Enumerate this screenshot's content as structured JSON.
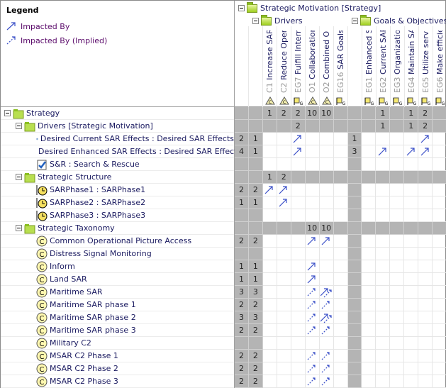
{
  "legend": {
    "title": "Legend",
    "items": [
      {
        "label": "Impacted By",
        "icon": "impact-arrow-icon"
      },
      {
        "label": "Impacted By (Implied)",
        "icon": "implied-arrow-icon"
      }
    ]
  },
  "colors": {
    "arrow": "#3a4fc8",
    "gray": "#b4b4b4"
  },
  "column_groups": {
    "root": "Strategic Motivation [Strategy]",
    "drivers": "Drivers",
    "goals": "Goals & Objectives"
  },
  "columns": [
    {
      "id": "",
      "name": "",
      "summary": true
    },
    {
      "id": "",
      "name": "",
      "summary": true
    },
    {
      "id": "C1",
      "name": "Increase SAR Sy",
      "icon": "concern"
    },
    {
      "id": "C2",
      "name": "Reduce Operati",
      "icon": "concern"
    },
    {
      "id": "EG7",
      "name": "Fulfill Internati",
      "icon": "goal"
    },
    {
      "id": "O1",
      "name": "Collaboration w",
      "icon": "concern"
    },
    {
      "id": "O2",
      "name": "Combined Oper",
      "icon": "concern"
    },
    {
      "id": "EG16",
      "name": "SAR Goals",
      "icon": "goal"
    },
    {
      "id": "",
      "name": "",
      "summary": true
    },
    {
      "id": "EG1",
      "name": "Enhanced SAR",
      "icon": "goal"
    },
    {
      "id": "EG2",
      "name": "Current SAR C",
      "icon": "goal"
    },
    {
      "id": "EG3",
      "name": "Organizational",
      "icon": "goal"
    },
    {
      "id": "EG4",
      "name": "Maintain SAR F",
      "icon": "goal"
    },
    {
      "id": "EG5",
      "name": "Utilize services",
      "icon": "goal"
    },
    {
      "id": "EG6",
      "name": "Make efficient",
      "icon": "goal"
    }
  ],
  "rows": [
    {
      "label": "Strategy",
      "level": 0,
      "icon": "folder",
      "summary": true,
      "cells": [
        "",
        "",
        "1",
        "2",
        "2",
        "10",
        "10",
        "",
        "",
        "",
        "1",
        "",
        "1",
        "2",
        ""
      ]
    },
    {
      "label": "Drivers [Strategic Motivation]",
      "level": 1,
      "icon": "folder",
      "summary": true,
      "cells": [
        "",
        "",
        "",
        "",
        "2",
        "",
        "",
        "",
        "",
        "",
        "1",
        "",
        "1",
        "2",
        ""
      ]
    },
    {
      "label": "Desired Current SAR Effects : Desired SAR Effects",
      "level": 2,
      "icon": "effect",
      "cells": [
        "2",
        "1",
        "",
        "",
        "A",
        "",
        "",
        "",
        "1",
        "",
        "",
        "",
        "",
        "A",
        ""
      ]
    },
    {
      "label": "Desired Enhanced SAR Effects : Desired SAR Effects",
      "level": 2,
      "icon": "effect",
      "cells": [
        "4",
        "1",
        "",
        "",
        "A",
        "",
        "",
        "",
        "3",
        "",
        "A",
        "",
        "A",
        "A",
        ""
      ]
    },
    {
      "label": "S&R : Search & Rescue",
      "level": 2,
      "icon": "capability",
      "cells": [
        "",
        "",
        "",
        "",
        "",
        "",
        "",
        "",
        "",
        "",
        "",
        "",
        "",
        "",
        ""
      ]
    },
    {
      "label": "Strategic Structure",
      "level": 1,
      "icon": "folder",
      "summary": true,
      "cells": [
        "",
        "",
        "1",
        "2",
        "",
        "",
        "",
        "",
        "",
        "",
        "",
        "",
        "",
        "",
        ""
      ]
    },
    {
      "label": "SARPhase1 : SARPhase1",
      "level": 2,
      "icon": "phase",
      "cells": [
        "2",
        "2",
        "A",
        "A",
        "",
        "",
        "",
        "",
        "",
        "",
        "",
        "",
        "",
        "",
        ""
      ]
    },
    {
      "label": "SARPhase2 : SARPhase2",
      "level": 2,
      "icon": "phase",
      "cells": [
        "1",
        "1",
        "",
        "A",
        "",
        "",
        "",
        "",
        "",
        "",
        "",
        "",
        "",
        "",
        ""
      ]
    },
    {
      "label": "SARPhase3 : SARPhase3",
      "level": 2,
      "icon": "phase",
      "cells": [
        "",
        "",
        "",
        "",
        "",
        "",
        "",
        "",
        "",
        "",
        "",
        "",
        "",
        "",
        ""
      ]
    },
    {
      "label": "Strategic Taxonomy",
      "level": 1,
      "icon": "folder",
      "summary": true,
      "cells": [
        "",
        "",
        "",
        "",
        "",
        "10",
        "10",
        "",
        "",
        "",
        "",
        "",
        "",
        "",
        ""
      ]
    },
    {
      "label": "Common Operational Picture Access",
      "level": 2,
      "icon": "capability-c",
      "cells": [
        "2",
        "2",
        "",
        "",
        "",
        "A",
        "A",
        "",
        "",
        "",
        "",
        "",
        "",
        "",
        ""
      ]
    },
    {
      "label": "Distress Signal Monitoring",
      "level": 2,
      "icon": "capability-c",
      "cells": [
        "",
        "",
        "",
        "",
        "",
        "",
        "",
        "",
        "",
        "",
        "",
        "",
        "",
        "",
        ""
      ]
    },
    {
      "label": "Inform",
      "level": 2,
      "icon": "capability-c",
      "cells": [
        "1",
        "1",
        "",
        "",
        "",
        "A",
        "",
        "",
        "",
        "",
        "",
        "",
        "",
        "",
        ""
      ]
    },
    {
      "label": "Land SAR",
      "level": 2,
      "icon": "capability-c",
      "cells": [
        "1",
        "1",
        "",
        "",
        "",
        "A",
        "",
        "",
        "",
        "",
        "",
        "",
        "",
        "",
        ""
      ]
    },
    {
      "label": "Maritime SAR",
      "level": 2,
      "icon": "capability-c",
      "cells": [
        "3",
        "3",
        "",
        "",
        "",
        "I",
        "B",
        "",
        "",
        "",
        "",
        "",
        "",
        "",
        ""
      ]
    },
    {
      "label": "Maritime SAR phase 1",
      "level": 2,
      "icon": "capability-c",
      "cells": [
        "2",
        "2",
        "",
        "",
        "",
        "I",
        "I",
        "",
        "",
        "",
        "",
        "",
        "",
        "",
        ""
      ]
    },
    {
      "label": "Maritime SAR phase 2",
      "level": 2,
      "icon": "capability-c",
      "cells": [
        "3",
        "3",
        "",
        "",
        "",
        "I",
        "B",
        "",
        "",
        "",
        "",
        "",
        "",
        "",
        ""
      ]
    },
    {
      "label": "Maritime SAR phase 3",
      "level": 2,
      "icon": "capability-c",
      "cells": [
        "2",
        "2",
        "",
        "",
        "",
        "I",
        "I",
        "",
        "",
        "",
        "",
        "",
        "",
        "",
        ""
      ]
    },
    {
      "label": "Military C2",
      "level": 2,
      "icon": "capability-c",
      "cells": [
        "",
        "",
        "",
        "",
        "",
        "",
        "",
        "",
        "",
        "",
        "",
        "",
        "",
        "",
        ""
      ]
    },
    {
      "label": "MSAR C2 Phase 1",
      "level": 2,
      "icon": "capability-c",
      "cells": [
        "2",
        "2",
        "",
        "",
        "",
        "I",
        "I",
        "",
        "",
        "",
        "",
        "",
        "",
        "",
        ""
      ]
    },
    {
      "label": "MSAR C2 Phase 2",
      "level": 2,
      "icon": "capability-c",
      "cells": [
        "2",
        "2",
        "",
        "",
        "",
        "I",
        "I",
        "",
        "",
        "",
        "",
        "",
        "",
        "",
        ""
      ]
    },
    {
      "label": "MSAR C2 Phase 3",
      "level": 2,
      "icon": "capability-c",
      "cells": [
        "2",
        "2",
        "",
        "",
        "",
        "I",
        "I",
        "",
        "",
        "",
        "",
        "",
        "",
        "",
        ""
      ]
    }
  ]
}
